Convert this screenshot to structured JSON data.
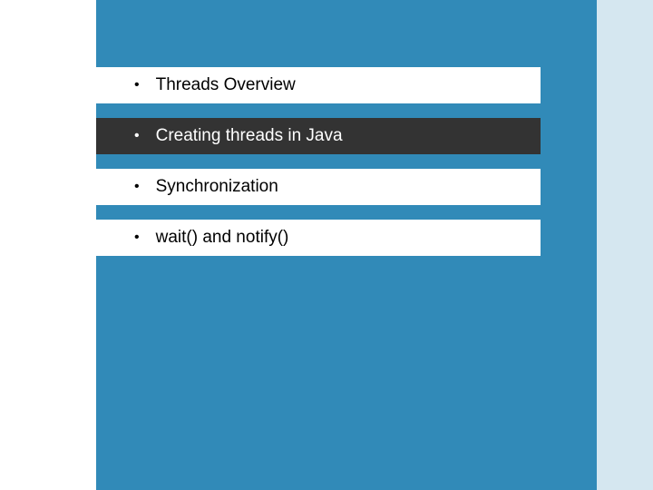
{
  "agenda": {
    "items": [
      {
        "label": "Threads Overview",
        "highlighted": false
      },
      {
        "label": "Creating threads in Java",
        "highlighted": true
      },
      {
        "label": "Synchronization",
        "highlighted": false
      },
      {
        "label": "wait() and notify()",
        "highlighted": false
      }
    ]
  },
  "colors": {
    "main_bg": "#318ab8",
    "right_bg": "#d5e7f0",
    "highlight_bg": "#333333",
    "item_bg": "#ffffff"
  }
}
